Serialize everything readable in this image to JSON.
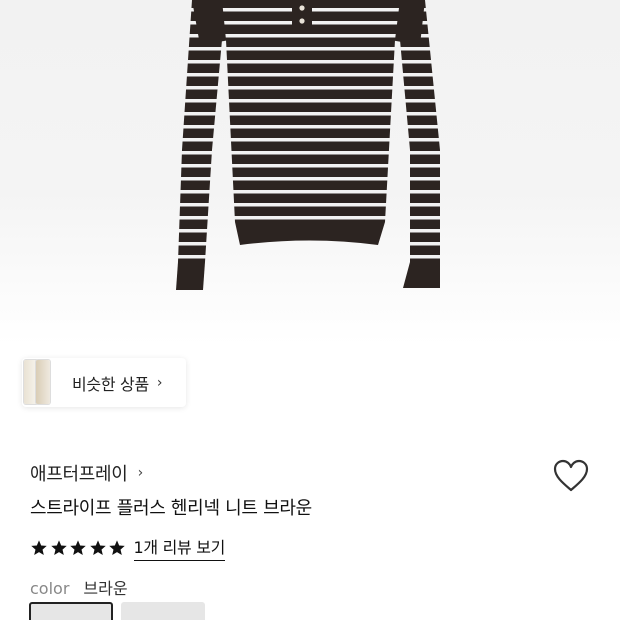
{
  "similar": {
    "label": "비슷한 상품",
    "arrow": "›"
  },
  "product": {
    "brand": "애프터프레이",
    "brand_arrow": "›",
    "name": "스트라이프 플러스 헨리넥 니트 브라운",
    "rating_stars": 5,
    "review_link": "1개 리뷰 보기",
    "color_label": "color",
    "color_value": "브라운"
  },
  "colors": {
    "sweater": "#2c2421",
    "stripe": "#f2f2f2",
    "star": "#111111"
  }
}
